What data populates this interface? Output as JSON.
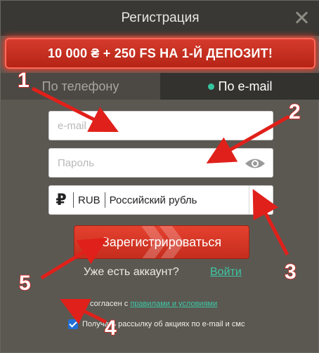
{
  "header": {
    "title": "Регистрация"
  },
  "promo": {
    "text": "10 000 ₴ + 250 FS НА 1-Й ДЕПОЗИТ!"
  },
  "tabs": [
    {
      "label": "По телефону",
      "active": false
    },
    {
      "label": "По e-mail",
      "active": true
    }
  ],
  "form": {
    "email_placeholder": "e-mail",
    "password_placeholder": "Пароль",
    "currency": {
      "symbol": "₽",
      "code": "RUB",
      "name": "Российский рубль"
    },
    "submit_label": "Зарегистрироваться"
  },
  "login": {
    "question": "Уже есть аккаунт?",
    "link": "Войти"
  },
  "agreements": [
    {
      "prefix": "Я согласен с ",
      "link": "правилами и условиями",
      "checked": true
    },
    {
      "text": "Получать рассылку об акциях по e-mail и смс",
      "checked": true
    }
  ],
  "annotations": [
    "1",
    "2",
    "3",
    "4",
    "5"
  ],
  "colors": {
    "accent_green": "#35c4a0",
    "button_red": "#d8382a",
    "checkbox_blue": "#1f6fd6",
    "arrow_red": "#e0201a"
  },
  "icons": {
    "close": "close-icon",
    "eye": "eye-icon",
    "dropdown": "chevron-down-icon"
  }
}
